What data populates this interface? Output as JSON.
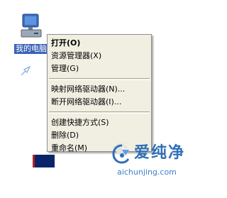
{
  "desktop": {
    "icon_label": "我的电脑"
  },
  "context_menu": {
    "items": [
      {
        "label": "打开(O)",
        "bold": true
      },
      {
        "label": "资源管理器(X)"
      },
      {
        "label": "管理(G)"
      },
      {
        "label": "映射网络驱动器(N)..."
      },
      {
        "label": "断开网络驱动器(I)..."
      },
      {
        "label": "创建快捷方式(S)"
      },
      {
        "label": "删除(D)"
      },
      {
        "label": "重命名(M)"
      }
    ]
  },
  "watermark": {
    "brand": "爱纯净",
    "url": "aichunjing.com"
  },
  "colors": {
    "menu_bg": "#f1efe2",
    "selection_blue": "#3a62b8",
    "watermark_blue": "#2f6fb5"
  }
}
